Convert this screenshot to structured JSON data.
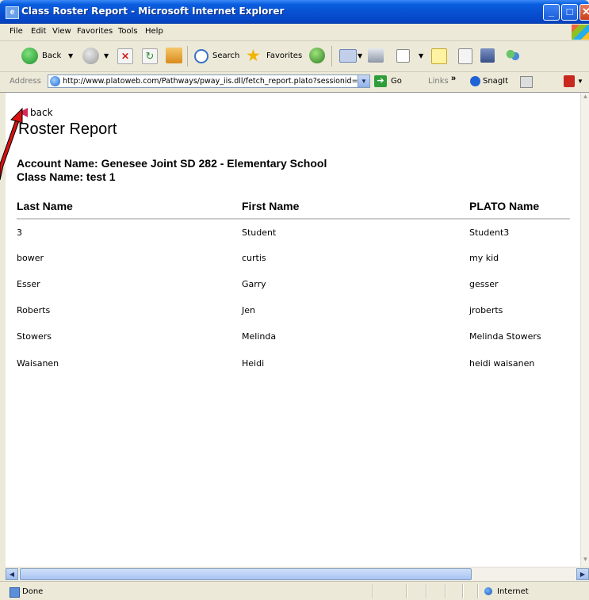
{
  "window": {
    "title": "Class Roster Report - Microsoft Internet Explorer"
  },
  "menu": [
    "File",
    "Edit",
    "View",
    "Favorites",
    "Tools",
    "Help"
  ],
  "toolbar": {
    "back_label": "Back",
    "search_label": "Search",
    "favorites_label": "Favorites"
  },
  "address": {
    "label": "Address",
    "url": "http://www.platoweb.com/Pathways/pway_iis.dll/fetch_report.plato?sessionid=",
    "go_label": "Go",
    "links_label": "Links",
    "snagit_label": "SnagIt"
  },
  "page": {
    "back_link": "back",
    "title": "Roster Report",
    "account": "Account Name: Genesee Joint SD 282 - Elementary School",
    "class_name": "Class Name: test 1",
    "columns": [
      "Last Name",
      "First Name",
      "PLATO Name"
    ],
    "rows": [
      [
        "3",
        "Student",
        "Student3"
      ],
      [
        "bower",
        "curtis",
        "my kid"
      ],
      [
        "Esser",
        "Garry",
        "gesser"
      ],
      [
        "Roberts",
        "Jen",
        "jroberts"
      ],
      [
        "Stowers",
        "Melinda",
        "Melinda Stowers"
      ],
      [
        "Waisanen",
        "Heidi",
        "heidi waisanen"
      ]
    ]
  },
  "status": {
    "text": "Done",
    "zone": "Internet"
  }
}
